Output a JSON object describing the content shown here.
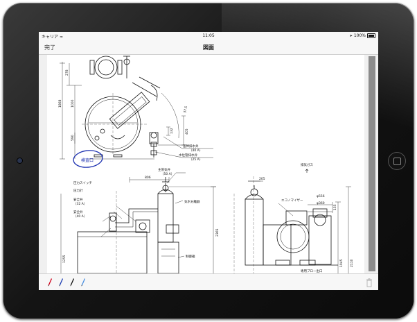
{
  "status_bar": {
    "carrier": "キャリア",
    "wifi_icon": "wifi-icon",
    "time": "11:05",
    "battery_percent": "100%"
  },
  "nav_bar": {
    "done_label": "完了",
    "title": "図面"
  },
  "drawing": {
    "labels": {
      "inspection_port": "検査口",
      "solid_drain_valve": "缶体排水弁",
      "solid_drain_size": "（40 A）",
      "level_drain_valve": "水位管排水弁",
      "level_drain_size": "（25 A）",
      "exhaust_gas": "排気ガス",
      "main_steam_valve": "主蒸気弁",
      "main_steam_size": "（50 A）",
      "pressure_switch": "圧力スイッチ",
      "pressure_gauge": "圧力計",
      "safety_valve_1": "安全弁",
      "safety_valve_1_size": "（32 A）",
      "safety_valve_2": "安全弁",
      "safety_valve_2_size": "（40 A）",
      "steam_separator": "気水分離器",
      "control_panel": "制御箱",
      "economizer": "エコノマイザー",
      "phi556": "φ556",
      "phi360": "φ360",
      "bottom_note": "専用ブロー出口"
    },
    "dimensions": {
      "d278": "278",
      "d1868": "1868",
      "d1000": "1000",
      "d590": "590",
      "d37_5": "37.5",
      "d132": "132",
      "d405": "405",
      "d806": "806",
      "d2365": "2365",
      "d1255": "1255",
      "d205": "205",
      "d155": "155",
      "d1945": "1945",
      "d2110": "2110"
    }
  },
  "toolbar": {
    "tools": [
      {
        "name": "red-pen-icon",
        "color": "#d0021b"
      },
      {
        "name": "blue-pen-icon",
        "color": "#1f3fb4"
      },
      {
        "name": "black-pen-icon",
        "color": "#111111"
      },
      {
        "name": "light-blue-pen-icon",
        "color": "#4a90e2"
      }
    ],
    "trash_icon": "trash-icon"
  },
  "colors": {
    "ink_annotation": "#1a2fb0",
    "chrome_bg": "#f7f7f7",
    "scrollbar": "#8c8c8c"
  }
}
